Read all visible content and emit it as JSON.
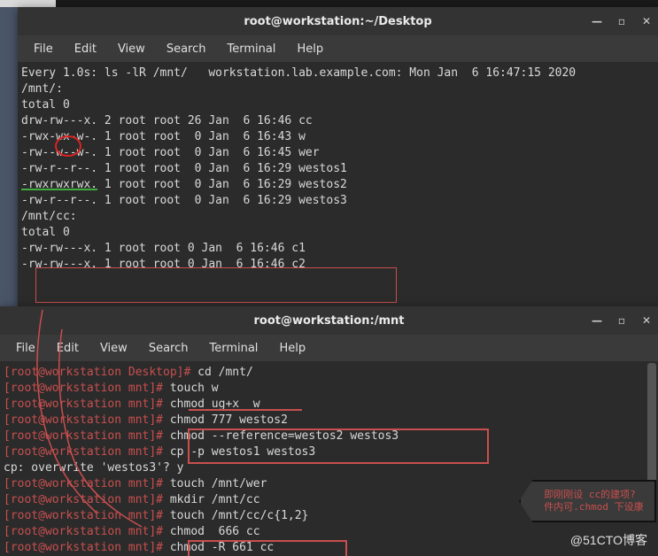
{
  "window1": {
    "title": "root@workstation:~/Desktop",
    "menu": [
      "File",
      "Edit",
      "View",
      "Search",
      "Terminal",
      "Help"
    ],
    "header_line": "Every 1.0s: ls -lR /mnt/   workstation.lab.example.com: Mon Jan  6 16:47:15 2020",
    "lines": [
      "",
      "/mnt/:",
      "total 0",
      "drw-rw---x. 2 root root 26 Jan  6 16:46 cc",
      "-rwx-wx-w-. 1 root root  0 Jan  6 16:43 w",
      "-rw--w--w-. 1 root root  0 Jan  6 16:45 wer",
      "-rw-r--r--. 1 root root  0 Jan  6 16:29 westos1",
      "-rwxrwxrwx. 1 root root  0 Jan  6 16:29 westos2",
      "-rw-r--r--. 1 root root  0 Jan  6 16:29 westos3",
      "",
      "/mnt/cc:",
      "total 0",
      "-rw-rw---x. 1 root root 0 Jan  6 16:46 c1",
      "-rw-rw---x. 1 root root 0 Jan  6 16:46 c2"
    ]
  },
  "window2": {
    "title": "root@workstation:/mnt",
    "menu": [
      "File",
      "Edit",
      "View",
      "Search",
      "Terminal",
      "Help"
    ],
    "lines_raw": [
      {
        "p": "[root@workstation Desktop]# ",
        "c": "cd /mnt/"
      },
      {
        "p": "[root@workstation mnt]# ",
        "c": "touch w"
      },
      {
        "p": "[root@workstation mnt]# ",
        "c": "chmod ug+x  w"
      },
      {
        "p": "[root@workstation mnt]# ",
        "c": "chmod 777 westos2"
      },
      {
        "p": "[root@workstation mnt]# ",
        "c": "chmod --reference=westos2 westos3"
      },
      {
        "p": "[root@workstation mnt]# ",
        "c": "cp -p westos1 westos3"
      },
      {
        "p": "",
        "c": "cp: overwrite 'westos3'? y"
      },
      {
        "p": "[root@workstation mnt]# ",
        "c": "touch /mnt/wer"
      },
      {
        "p": "[root@workstation mnt]# ",
        "c": "mkdir /mnt/cc"
      },
      {
        "p": "[root@workstation mnt]# ",
        "c": "touch /mnt/cc/c{1,2}"
      },
      {
        "p": "[root@workstation mnt]# ",
        "c": "chmod  666 cc"
      },
      {
        "p": "[root@workstation mnt]# ",
        "c": "chmod -R 661 cc"
      }
    ]
  },
  "callout": {
    "line1": "即刚刚设 cc的建项?",
    "line2": "件内可.chmod 下设康"
  },
  "watermark": "@51CTO博客",
  "controls": {
    "min": "—",
    "max": "▫",
    "close": "✕"
  }
}
